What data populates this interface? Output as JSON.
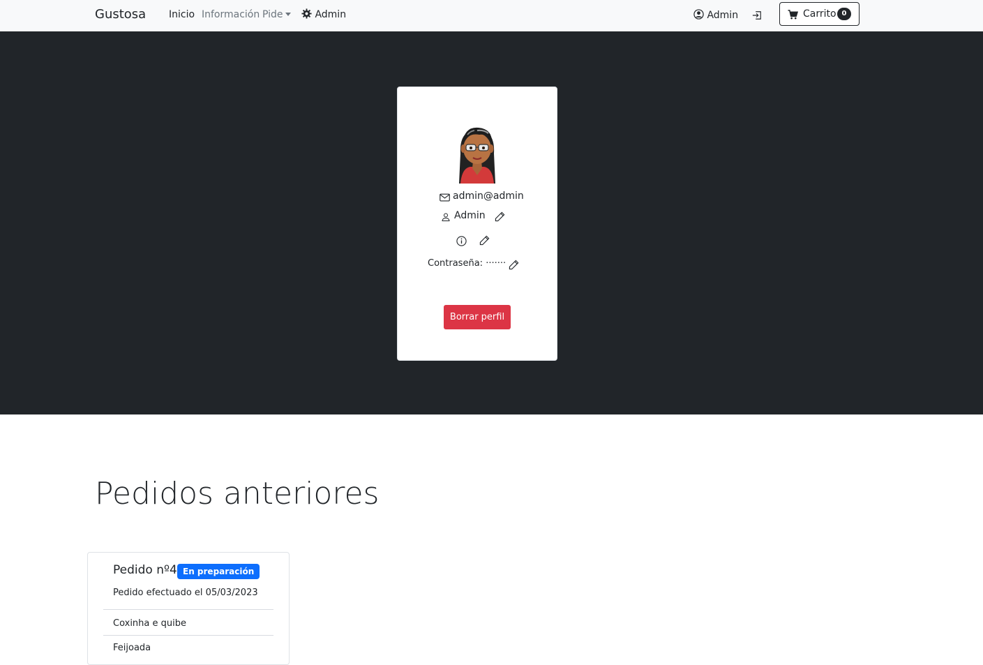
{
  "navbar": {
    "brand": "Gustosa",
    "links": [
      {
        "label": "Inicio"
      },
      {
        "label": "Información"
      },
      {
        "label": "Pide"
      },
      {
        "label": "Admin"
      }
    ],
    "user_label": "Admin",
    "cart_label": "Carrito",
    "cart_count": "0"
  },
  "profile": {
    "email": "admin@admin",
    "name": "Admin",
    "password_label": "Contraseña:",
    "password_mask": "·······",
    "delete_button": "Borrar perfil"
  },
  "orders": {
    "title": "Pedidos anteriores",
    "items": [
      {
        "title": "Pedido nº4",
        "status": "En preparación",
        "date": "Pedido efectuado el 05/03/2023",
        "products": [
          "Coxinha e quibe",
          "Feijoada"
        ]
      }
    ]
  },
  "colors": {
    "navbar_bg": "#f8f9fa",
    "hero_bg": "#212529",
    "danger": "#dc3545",
    "primary": "#0d6efd"
  }
}
